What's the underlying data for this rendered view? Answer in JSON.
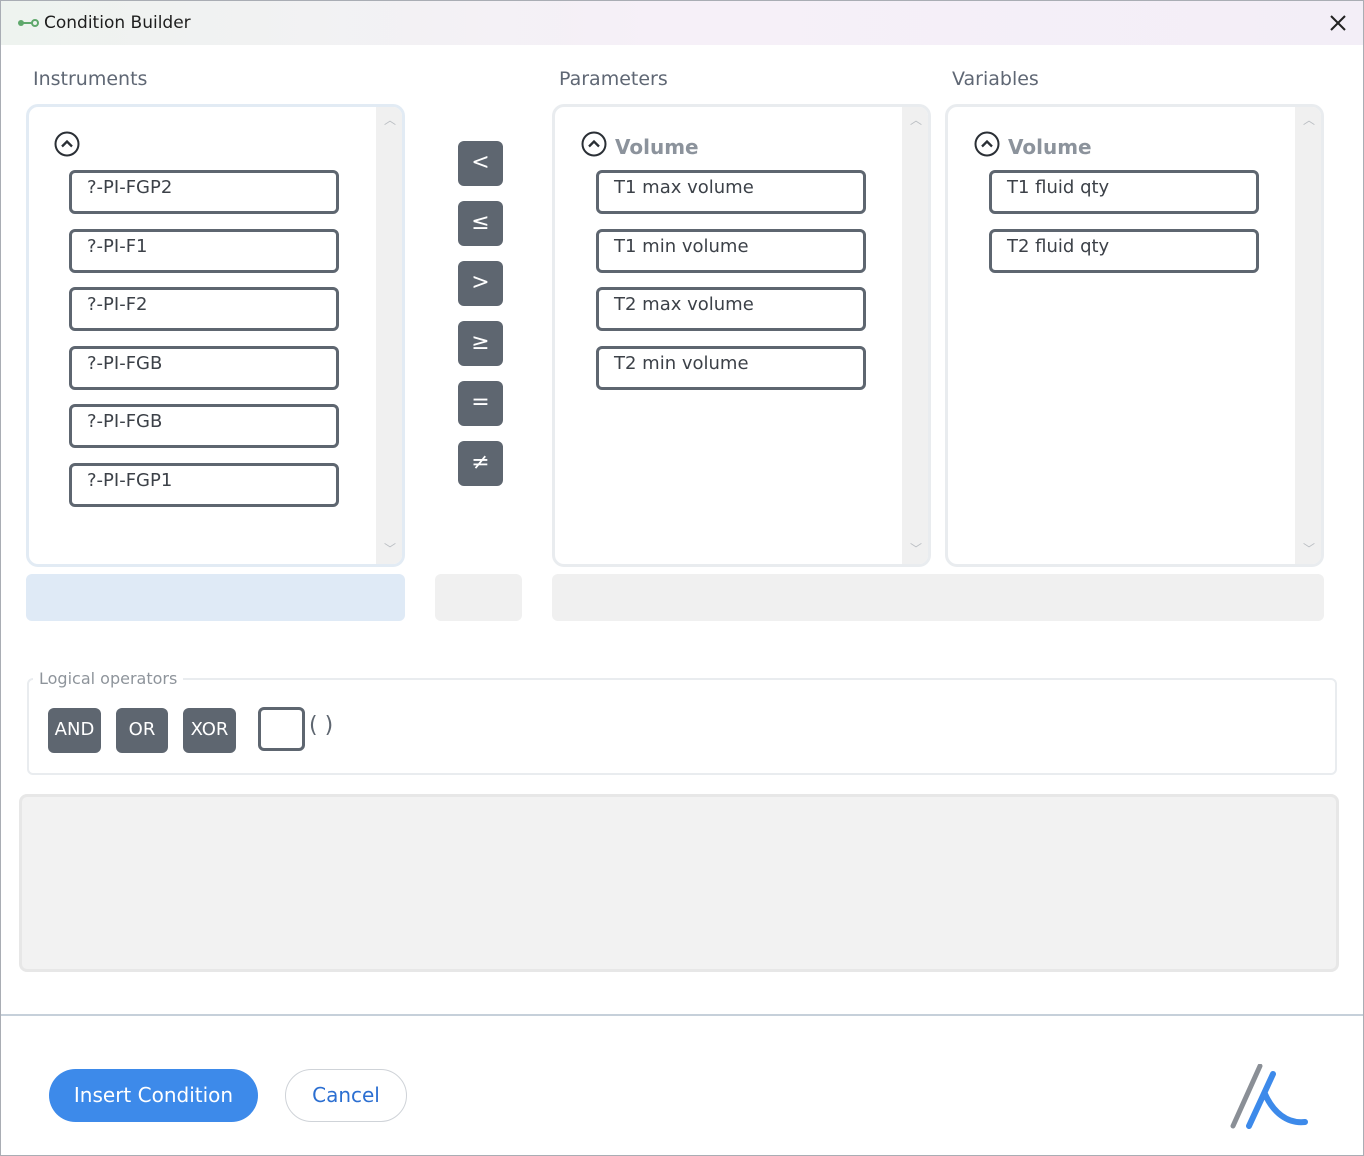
{
  "window": {
    "title": "Condition Builder",
    "app_icon": "link-icon",
    "close_icon": "close-icon"
  },
  "instruments": {
    "header": "Instruments",
    "items": [
      "?-PI-FGP2",
      "?-PI-F1",
      "?-PI-F2",
      "?-PI-FGB",
      "?-PI-FGB",
      "?-PI-FGP1"
    ]
  },
  "comparison_operators": [
    "<",
    "≤",
    ">",
    "≥",
    "=",
    "≠"
  ],
  "parameters": {
    "header": "Parameters",
    "group": "Volume",
    "items": [
      "T1 max volume",
      "T1 min volume",
      "T2 max volume",
      "T2 min volume"
    ]
  },
  "variables": {
    "header": "Variables",
    "group": "Volume",
    "items": [
      "T1 fluid qty",
      "T2 fluid qty"
    ]
  },
  "logical": {
    "legend": "Logical operators",
    "buttons": [
      "AND",
      "OR",
      "XOR"
    ],
    "parentheses_label": "( )"
  },
  "footer": {
    "insert_label": "Insert Condition",
    "cancel_label": "Cancel"
  },
  "colors": {
    "accent": "#3d8aea",
    "operator_button": "#5e6670",
    "instrument_selection_bar": "#dfeaf6"
  }
}
